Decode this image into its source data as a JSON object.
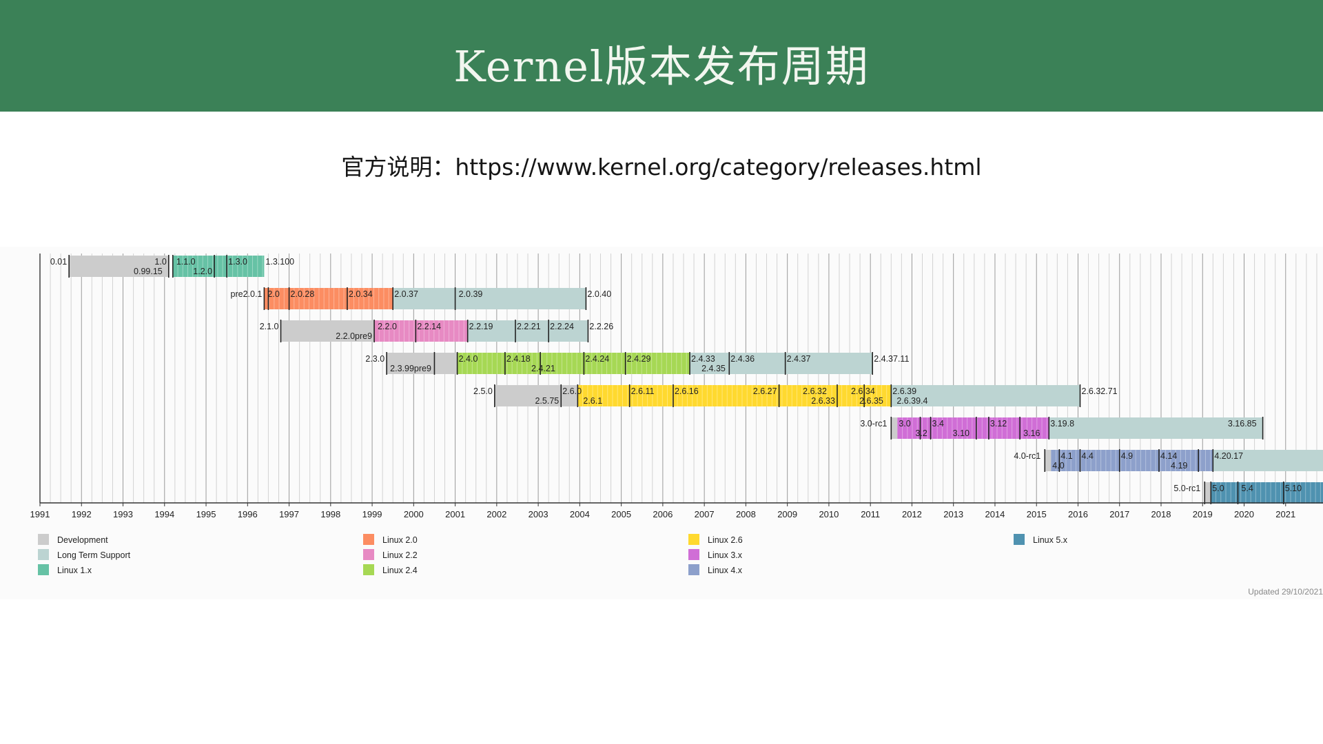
{
  "page": {
    "title": "Kernel版本发布周期",
    "subtitle": "官方说明：https://www.kernel.org/category/releases.html"
  },
  "chart_data": {
    "type": "timeline",
    "xlim": [
      1991.0,
      2021.9
    ],
    "x_ticks": [
      1991,
      1992,
      1993,
      1994,
      1995,
      1996,
      1997,
      1998,
      1999,
      2000,
      2001,
      2002,
      2003,
      2004,
      2005,
      2006,
      2007,
      2008,
      2009,
      2010,
      2011,
      2012,
      2013,
      2014,
      2015,
      2016,
      2017,
      2018,
      2019,
      2020,
      2021
    ],
    "grid": true,
    "updated": "Updated 29/10/2021",
    "colors": {
      "Development": "#cccccc",
      "Long Term Support": "#bcd4d2",
      "Linux 1.x": "#66c2a5",
      "Linux 2.0": "#fc8d62",
      "Linux 2.2": "#e78ac3",
      "Linux 2.4": "#a6d854",
      "Linux 2.6": "#ffd92f",
      "Linux 3.x": "#d06ed6",
      "Linux 4.x": "#8da0cb",
      "Linux 5.x": "#4f92b0"
    },
    "legend": [
      {
        "name": "Development",
        "color": "#cccccc"
      },
      {
        "name": "Long Term Support",
        "color": "#bcd4d2"
      },
      {
        "name": "Linux 1.x",
        "color": "#66c2a5"
      },
      {
        "name": "Linux 2.0",
        "color": "#fc8d62"
      },
      {
        "name": "Linux 2.2",
        "color": "#e78ac3"
      },
      {
        "name": "Linux 2.4",
        "color": "#a6d854"
      },
      {
        "name": "Linux 2.6",
        "color": "#ffd92f"
      },
      {
        "name": "Linux 3.x",
        "color": "#d06ed6"
      },
      {
        "name": "Linux 4.x",
        "color": "#8da0cb"
      },
      {
        "name": "Linux 5.x",
        "color": "#4f92b0"
      }
    ],
    "rows": [
      {
        "segments": [
          {
            "start": 1991.7,
            "end": 1994.1,
            "kind": "Development"
          },
          {
            "start": 1994.2,
            "end": 1996.4,
            "kind": "Linux 1.x"
          }
        ],
        "markers": [
          1991.7,
          1994.1,
          1994.2,
          1995.2,
          1995.5
        ],
        "labels": [
          {
            "text": "0.01",
            "x": 1991.7,
            "level": "top",
            "align": "left-of"
          },
          {
            "text": "1.0",
            "x": 1994.1,
            "level": "top",
            "align": "left-of"
          },
          {
            "text": "0.99.15",
            "x": 1994.0,
            "level": "bottom",
            "align": "left-of"
          },
          {
            "text": "1.1.0",
            "x": 1994.25,
            "level": "top",
            "align": "inside"
          },
          {
            "text": "1.2.0",
            "x": 1995.2,
            "level": "bottom",
            "align": "left-of"
          },
          {
            "text": "1.3.0",
            "x": 1995.5,
            "level": "top",
            "align": "inside"
          },
          {
            "text": "1.3.100",
            "x": 1996.4,
            "level": "top",
            "align": "inside"
          }
        ]
      },
      {
        "segments": [
          {
            "start": 1996.4,
            "end": 1999.5,
            "kind": "Linux 2.0"
          },
          {
            "start": 1999.5,
            "end": 2004.15,
            "kind": "Long Term Support"
          }
        ],
        "markers": [
          1996.4,
          1996.5,
          1997.0,
          1998.4,
          1999.5,
          2001.0,
          2004.15
        ],
        "labels": [
          {
            "text": "pre2.0.1",
            "x": 1996.4,
            "level": "top",
            "align": "left-of"
          },
          {
            "text": "2.0",
            "x": 1996.45,
            "level": "top",
            "align": "inside"
          },
          {
            "text": "2.0.28",
            "x": 1997.0,
            "level": "top",
            "align": "inside"
          },
          {
            "text": "2.0.34",
            "x": 1998.4,
            "level": "top",
            "align": "inside"
          },
          {
            "text": "2.0.37",
            "x": 1999.5,
            "level": "top",
            "align": "inside"
          },
          {
            "text": "2.0.39",
            "x": 2001.05,
            "level": "top",
            "align": "inside"
          },
          {
            "text": "2.0.40",
            "x": 2004.15,
            "level": "top",
            "align": "inside"
          }
        ]
      },
      {
        "segments": [
          {
            "start": 1996.8,
            "end": 1999.05,
            "kind": "Development"
          },
          {
            "start": 1999.05,
            "end": 2001.3,
            "kind": "Linux 2.2"
          },
          {
            "start": 2001.3,
            "end": 2004.2,
            "kind": "Long Term Support"
          }
        ],
        "markers": [
          1996.8,
          1999.05,
          2000.05,
          2001.3,
          2002.45,
          2003.25,
          2004.2
        ],
        "labels": [
          {
            "text": "2.1.0",
            "x": 1996.8,
            "level": "top",
            "align": "left-of"
          },
          {
            "text": "2.2.0pre9",
            "x": 1999.05,
            "level": "bottom",
            "align": "left-of"
          },
          {
            "text": "2.2.0",
            "x": 1999.1,
            "level": "top",
            "align": "inside"
          },
          {
            "text": "2.2.14",
            "x": 2000.05,
            "level": "top",
            "align": "inside"
          },
          {
            "text": "2.2.19",
            "x": 2001.3,
            "level": "top",
            "align": "inside"
          },
          {
            "text": "2.2.21",
            "x": 2002.45,
            "level": "top",
            "align": "inside"
          },
          {
            "text": "2.2.24",
            "x": 2003.25,
            "level": "top",
            "align": "inside"
          },
          {
            "text": "2.2.26",
            "x": 2004.2,
            "level": "top",
            "align": "inside"
          }
        ]
      },
      {
        "segments": [
          {
            "start": 1999.35,
            "end": 2001.05,
            "kind": "Development"
          },
          {
            "start": 2001.05,
            "end": 2006.65,
            "kind": "Linux 2.4"
          },
          {
            "start": 2006.65,
            "end": 2011.05,
            "kind": "Long Term Support"
          }
        ],
        "markers": [
          1999.35,
          2000.5,
          2001.05,
          2002.2,
          2003.05,
          2004.1,
          2005.1,
          2006.65,
          2007.6,
          2008.95,
          2011.05
        ],
        "labels": [
          {
            "text": "2.3.0",
            "x": 1999.35,
            "level": "top",
            "align": "left-of"
          },
          {
            "text": "2.3.99pre9",
            "x": 1999.4,
            "level": "bottom",
            "align": "inside"
          },
          {
            "text": "2.4.0",
            "x": 2001.05,
            "level": "top",
            "align": "inside"
          },
          {
            "text": "2.4.18",
            "x": 2002.2,
            "level": "top",
            "align": "inside"
          },
          {
            "text": "2.4.21",
            "x": 2002.8,
            "level": "bottom",
            "align": "inside"
          },
          {
            "text": "2.4.24",
            "x": 2004.1,
            "level": "top",
            "align": "inside"
          },
          {
            "text": "2.4.29",
            "x": 2005.1,
            "level": "top",
            "align": "inside"
          },
          {
            "text": "2.4.33",
            "x": 2006.65,
            "level": "top",
            "align": "inside"
          },
          {
            "text": "2.4.35",
            "x": 2006.9,
            "level": "bottom",
            "align": "inside"
          },
          {
            "text": "2.4.36",
            "x": 2007.6,
            "level": "top",
            "align": "inside"
          },
          {
            "text": "2.4.37",
            "x": 2008.95,
            "level": "top",
            "align": "inside"
          },
          {
            "text": "2.4.37.11",
            "x": 2011.05,
            "level": "top",
            "align": "inside"
          }
        ]
      },
      {
        "segments": [
          {
            "start": 2001.95,
            "end": 2003.95,
            "kind": "Development"
          },
          {
            "start": 2003.95,
            "end": 2011.5,
            "kind": "Linux 2.6"
          },
          {
            "start": 2011.5,
            "end": 2016.05,
            "kind": "Long Term Support"
          }
        ],
        "markers": [
          2001.95,
          2003.55,
          2003.95,
          2005.2,
          2006.25,
          2008.8,
          2010.2,
          2010.85,
          2011.5,
          2016.05
        ],
        "labels": [
          {
            "text": "2.5.0",
            "x": 2001.95,
            "level": "top",
            "align": "left-of"
          },
          {
            "text": "2.5.75",
            "x": 2003.55,
            "level": "bottom",
            "align": "left-of"
          },
          {
            "text": "2.6.0",
            "x": 2003.55,
            "level": "top",
            "align": "inside"
          },
          {
            "text": "2.6.1",
            "x": 2004.05,
            "level": "bottom",
            "align": "inside"
          },
          {
            "text": "2.6.11",
            "x": 2005.2,
            "level": "top",
            "align": "inside"
          },
          {
            "text": "2.6.16",
            "x": 2006.25,
            "level": "top",
            "align": "inside"
          },
          {
            "text": "2.6.27",
            "x": 2008.8,
            "level": "top",
            "align": "left-of"
          },
          {
            "text": "2.6.32",
            "x": 2010.0,
            "level": "top",
            "align": "left-of"
          },
          {
            "text": "2.6.33",
            "x": 2010.2,
            "level": "bottom",
            "align": "left-of"
          },
          {
            "text": "2.6.34",
            "x": 2010.5,
            "level": "top",
            "align": "inside"
          },
          {
            "text": "2.6.35",
            "x": 2010.7,
            "level": "bottom",
            "align": "inside"
          },
          {
            "text": "2.6.39",
            "x": 2011.5,
            "level": "top",
            "align": "inside"
          },
          {
            "text": "2.6.39.4",
            "x": 2011.6,
            "level": "bottom",
            "align": "inside"
          },
          {
            "text": "2.6.32.71",
            "x": 2016.05,
            "level": "top",
            "align": "inside"
          }
        ]
      },
      {
        "segments": [
          {
            "start": 2011.5,
            "end": 2011.65,
            "kind": "Development"
          },
          {
            "start": 2011.65,
            "end": 2015.3,
            "kind": "Linux 3.x"
          },
          {
            "start": 2015.3,
            "end": 2020.45,
            "kind": "Long Term Support"
          }
        ],
        "markers": [
          2011.5,
          2012.2,
          2012.45,
          2013.55,
          2013.85,
          2014.6,
          2015.3,
          2020.45
        ],
        "labels": [
          {
            "text": "3.0-rc1",
            "x": 2011.45,
            "level": "top",
            "align": "left-of"
          },
          {
            "text": "3.0",
            "x": 2011.65,
            "level": "top",
            "align": "inside"
          },
          {
            "text": "3.2",
            "x": 2012.05,
            "level": "bottom",
            "align": "inside"
          },
          {
            "text": "3.4",
            "x": 2012.45,
            "level": "top",
            "align": "inside"
          },
          {
            "text": "3.10",
            "x": 2012.95,
            "level": "bottom",
            "align": "inside"
          },
          {
            "text": "3.12",
            "x": 2013.85,
            "level": "top",
            "align": "inside"
          },
          {
            "text": "3.16",
            "x": 2014.65,
            "level": "bottom",
            "align": "inside"
          },
          {
            "text": "3.19.8",
            "x": 2015.3,
            "level": "top",
            "align": "inside"
          },
          {
            "text": "3.16.85",
            "x": 2020.35,
            "level": "top",
            "align": "left-of"
          }
        ]
      },
      {
        "segments": [
          {
            "start": 2015.2,
            "end": 2015.35,
            "kind": "Development"
          },
          {
            "start": 2015.35,
            "end": 2019.25,
            "kind": "Linux 4.x"
          },
          {
            "start": 2019.25,
            "end": 2021.9,
            "kind": "Long Term Support"
          }
        ],
        "markers": [
          2015.2,
          2015.55,
          2016.05,
          2017.0,
          2017.95,
          2018.9,
          2019.25
        ],
        "labels": [
          {
            "text": "4.0-rc1",
            "x": 2015.15,
            "level": "top",
            "align": "left-of"
          },
          {
            "text": "4.0",
            "x": 2015.35,
            "level": "bottom",
            "align": "inside"
          },
          {
            "text": "4.1",
            "x": 2015.55,
            "level": "top",
            "align": "inside"
          },
          {
            "text": "4.4",
            "x": 2016.05,
            "level": "top",
            "align": "inside"
          },
          {
            "text": "4.9",
            "x": 2017.0,
            "level": "top",
            "align": "inside"
          },
          {
            "text": "4.14",
            "x": 2017.95,
            "level": "top",
            "align": "inside"
          },
          {
            "text": "4.19",
            "x": 2018.2,
            "level": "bottom",
            "align": "inside"
          },
          {
            "text": "4.20.17",
            "x": 2019.25,
            "level": "top",
            "align": "inside"
          }
        ]
      },
      {
        "segments": [
          {
            "start": 2019.05,
            "end": 2019.2,
            "kind": "Development"
          },
          {
            "start": 2019.2,
            "end": 2021.9,
            "kind": "Linux 5.x"
          }
        ],
        "markers": [
          2019.05,
          2019.2,
          2019.85,
          2020.95
        ],
        "labels": [
          {
            "text": "5.0-rc1",
            "x": 2019.0,
            "level": "top",
            "align": "left-of"
          },
          {
            "text": "5.0",
            "x": 2019.2,
            "level": "top",
            "align": "inside"
          },
          {
            "text": "5.4",
            "x": 2019.9,
            "level": "top",
            "align": "inside"
          },
          {
            "text": "5.10",
            "x": 2020.95,
            "level": "top",
            "align": "inside"
          }
        ]
      }
    ]
  }
}
